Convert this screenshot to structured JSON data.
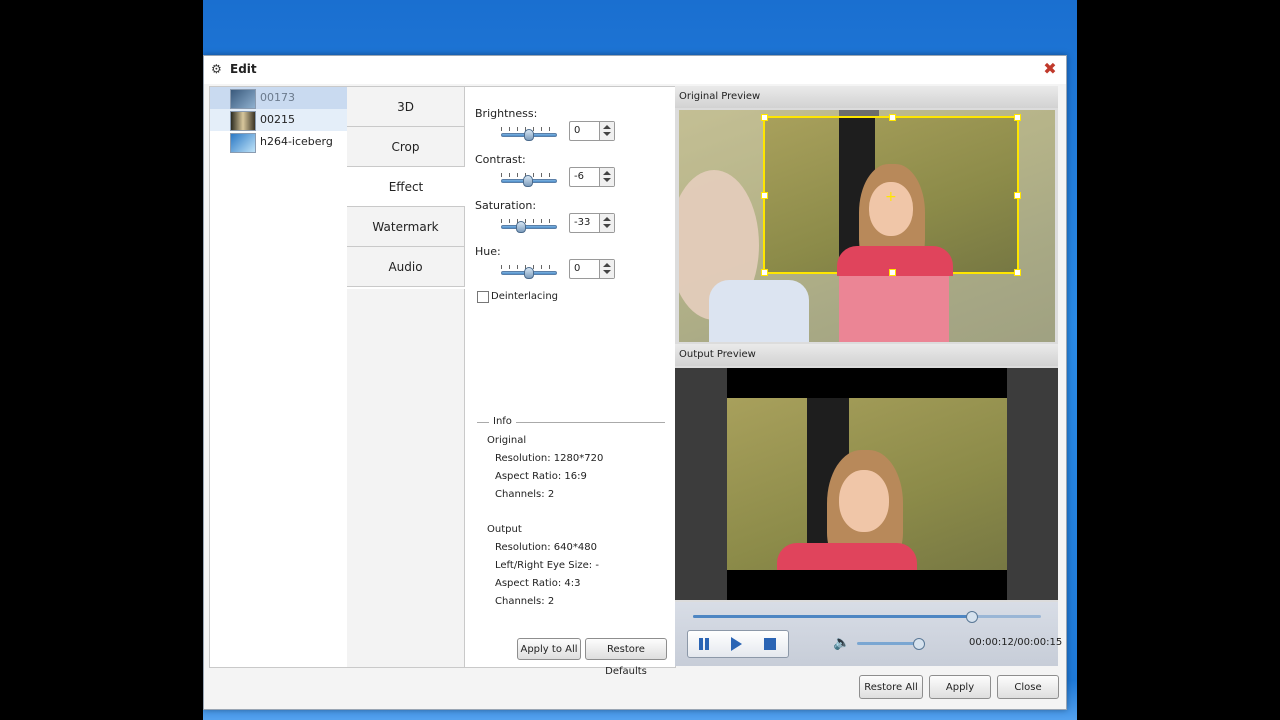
{
  "window": {
    "title": "Edit"
  },
  "files": [
    {
      "name": "00173",
      "selected": true
    },
    {
      "name": "00215",
      "selected": false
    },
    {
      "name": "h264-iceberg",
      "selected": false
    }
  ],
  "tabs": [
    "3D",
    "Crop",
    "Effect",
    "Watermark",
    "Audio"
  ],
  "active_tab": "Effect",
  "effects": {
    "brightness": {
      "label": "Brightness:",
      "value": "0",
      "level": 0.5
    },
    "contrast": {
      "label": "Contrast:",
      "value": "-6",
      "level": 0.47
    },
    "saturation": {
      "label": "Saturation:",
      "value": "-33",
      "level": 0.33
    },
    "hue": {
      "label": "Hue:",
      "value": "0",
      "level": 0.5
    },
    "deinterlacing": {
      "label": "Deinterlacing",
      "checked": false
    }
  },
  "info": {
    "title": "Info",
    "original_label": "Original",
    "original_resolution": "Resolution: 1280*720",
    "original_aspect": "Aspect Ratio: 16:9",
    "original_channels": "Channels: 2",
    "output_label": "Output",
    "output_resolution": "Resolution: 640*480",
    "output_eye": "Left/Right Eye Size: -",
    "output_aspect": "Aspect Ratio: 4:3",
    "output_channels": "Channels: 2"
  },
  "panel_buttons": {
    "apply_all": "Apply to All",
    "restore_defaults": "Restore Defaults"
  },
  "preview": {
    "original_title": "Original Preview",
    "output_title": "Output Preview",
    "progress": 0.8,
    "volume": 0.9,
    "time": "00:00:12/00:00:15"
  },
  "footer": {
    "restore_all": "Restore All",
    "apply": "Apply",
    "close": "Close"
  },
  "colors": {
    "crop_box": "#ffe600",
    "selection": "#c9daf0",
    "close": "#c0392b"
  }
}
